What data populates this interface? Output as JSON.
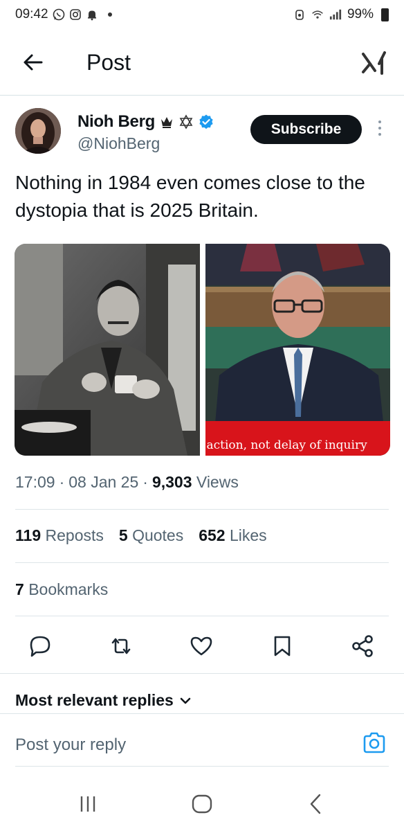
{
  "status_bar": {
    "time": "09:42",
    "battery": "99%"
  },
  "header": {
    "title": "Post"
  },
  "author": {
    "name": "Nioh Berg",
    "handle": "@NiohBerg",
    "badges": [
      "crown-icon",
      "star-of-david-icon",
      "verified-icon"
    ],
    "subscribe_label": "Subscribe"
  },
  "post": {
    "text": "Nothing in 1984 even comes close to the dystopia that is 2025 Britain.",
    "media": {
      "caption": "action, not delay of inquiry"
    }
  },
  "meta": {
    "time": "17:09",
    "date": "08 Jan 25",
    "views_count": "9,303",
    "views_label": "Views"
  },
  "stats": {
    "reposts_count": "119",
    "reposts_label": "Reposts",
    "quotes_count": "5",
    "quotes_label": "Quotes",
    "likes_count": "652",
    "likes_label": "Likes",
    "bookmarks_count": "7",
    "bookmarks_label": "Bookmarks"
  },
  "replies": {
    "sort_label": "Most relevant replies",
    "placeholder": "Post your reply"
  },
  "colors": {
    "text": "#0f1419",
    "secondary": "#536471",
    "verified": "#1d9bf0",
    "camera": "#1d9bf0",
    "caption_red": "#d8141b"
  }
}
